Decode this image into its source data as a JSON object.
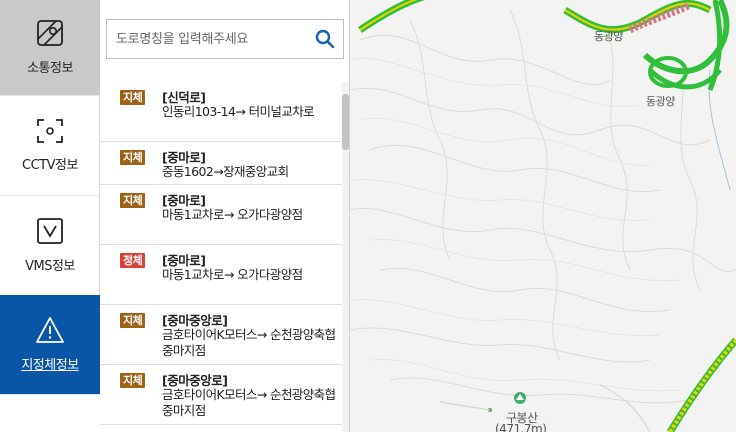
{
  "nav": {
    "items": [
      {
        "label": "소통정보",
        "icon": "traffic-map-icon"
      },
      {
        "label": "CCTV정보",
        "icon": "cctv-icon"
      },
      {
        "label": "VMS정보",
        "icon": "vms-icon"
      },
      {
        "label": "지정체정보",
        "icon": "warning-icon"
      }
    ]
  },
  "search": {
    "placeholder": "도로명칭을 입력해주세요"
  },
  "incidents": [
    {
      "status": "지체",
      "road": "[신덕로]",
      "desc": "인동리103-14→ 터미널교차로"
    },
    {
      "status": "지체",
      "road": "[중마로]",
      "desc": "중동1602→장재중앙교회"
    },
    {
      "status": "지체",
      "road": "[중마로]",
      "desc": "마동1교차로→ 오가다광양점"
    },
    {
      "status": "정체",
      "road": "[중마로]",
      "desc": "마동1교차로→ 오가다광양점"
    },
    {
      "status": "지체",
      "road": "[중마중앙로]",
      "desc": "금호타이어K모터스→ 순천광양축협중마지점"
    },
    {
      "status": "지체",
      "road": "[중마중앙로]",
      "desc": "금호타이어K모터스→ 순천광양축협중마지점"
    }
  ],
  "map": {
    "labels": [
      {
        "text": "동광양"
      },
      {
        "text": "동광양"
      },
      {
        "text": "구봉산"
      },
      {
        "text": "(471.7m)"
      }
    ]
  },
  "colors": {
    "nav_active": "#0a56a6",
    "nav_selected": "#c9c9c9",
    "slow_badge": "#9c6317",
    "jam_badge": "#d9403a",
    "road_green": "#2fbf3a",
    "road_yellow": "#f0d000",
    "road_pink": "#d9768c"
  }
}
